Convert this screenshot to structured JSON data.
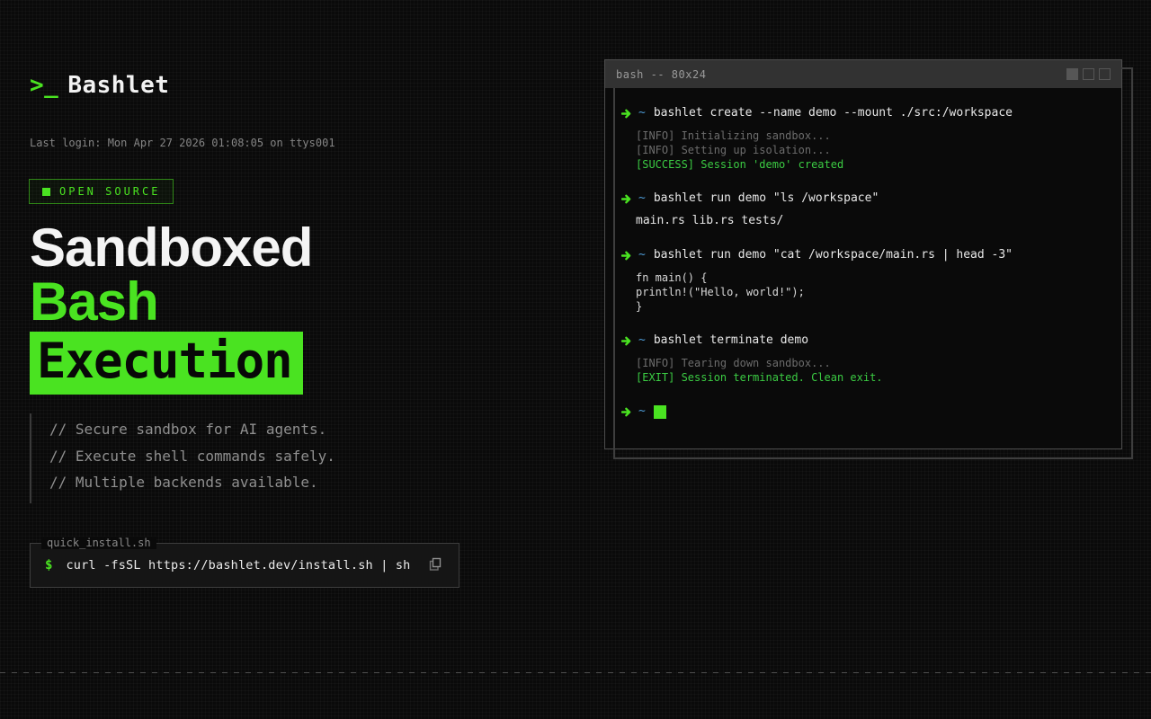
{
  "accent_color": "#4ae321",
  "logo": {
    "prompt": ">_",
    "name": "Bashlet"
  },
  "last_login": "Last login: Mon Apr 27 2026 01:08:05 on ttys001",
  "badge": {
    "label": "OPEN SOURCE"
  },
  "headline": {
    "line1": "Sandboxed",
    "line2": "Bash",
    "line3": "Execution"
  },
  "features": [
    "// Secure sandbox for AI agents.",
    "// Execute shell commands safely.",
    "// Multiple backends available."
  ],
  "install": {
    "filename": "quick_install.sh",
    "prompt": "$",
    "command": "curl -fsSL https://bashlet.dev/install.sh | sh"
  },
  "terminal": {
    "title": "bash -- 80x24",
    "prompt_path": "~",
    "lines": [
      {
        "type": "cmd",
        "text": "bashlet create --name demo --mount ./src:/workspace"
      },
      {
        "type": "info",
        "text": "[INFO] Initializing sandbox..."
      },
      {
        "type": "info",
        "text": "[INFO] Setting up isolation..."
      },
      {
        "type": "success",
        "text": "[SUCCESS] Session 'demo' created"
      },
      {
        "type": "gap"
      },
      {
        "type": "cmd",
        "text": "bashlet run demo \"ls /workspace\""
      },
      {
        "type": "out",
        "text": "main.rs lib.rs tests/"
      },
      {
        "type": "gap"
      },
      {
        "type": "cmd",
        "text": "bashlet run demo \"cat /workspace/main.rs | head -3\""
      },
      {
        "type": "code",
        "text": "fn main() {"
      },
      {
        "type": "code",
        "text": "println!(\"Hello, world!\");"
      },
      {
        "type": "code",
        "text": "}"
      },
      {
        "type": "gap"
      },
      {
        "type": "cmd",
        "text": "bashlet terminate demo"
      },
      {
        "type": "info",
        "text": "[INFO] Tearing down sandbox..."
      },
      {
        "type": "exit",
        "text": "[EXIT] Session terminated. Clean exit."
      },
      {
        "type": "gap"
      },
      {
        "type": "prompt"
      }
    ]
  }
}
